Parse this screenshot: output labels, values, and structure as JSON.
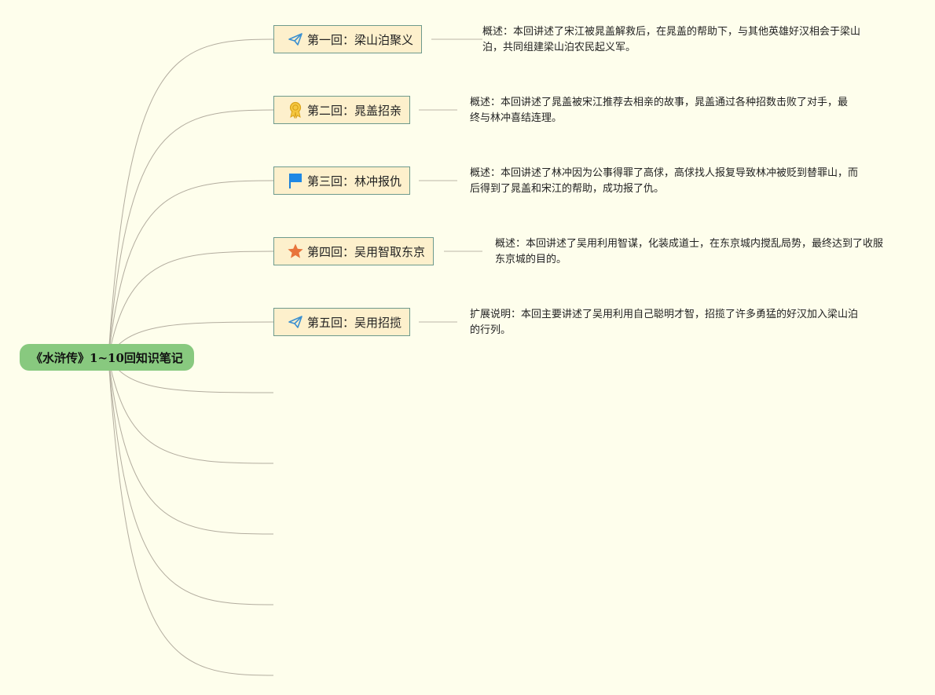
{
  "root": {
    "label": "《水浒传》1~10回知识笔记"
  },
  "chapters": [
    {
      "title": "第一回：梁山泊聚义",
      "icon": "paper-plane-icon",
      "note": "概述：本回讲述了宋江被晁盖解救后，在晁盖的帮助下，与其他英雄好汉相会于梁山泊，共同组建梁山泊农民起义军。"
    },
    {
      "title": "第二回：晁盖招亲",
      "icon": "award-medal-icon",
      "note": "概述：本回讲述了晁盖被宋江推荐去相亲的故事，晁盖通过各种招数击败了对手，最终与林冲喜结连理。"
    },
    {
      "title": "第三回：林冲报仇",
      "icon": "flag-icon",
      "note": "概述：本回讲述了林冲因为公事得罪了高俅，高俅找人报复导致林冲被贬到替罪山，而后得到了晁盖和宋江的帮助，成功报了仇。"
    },
    {
      "title": "第四回：吴用智取东京",
      "icon": "star-icon",
      "note": "概述：本回讲述了吴用利用智谋，化装成道士，在东京城内搅乱局势，最终达到了收服东京城的目的。"
    },
    {
      "title": "第五回：吴用招揽",
      "icon": "paper-plane-icon",
      "note": "扩展说明：本回主要讲述了吴用利用自己聪明才智，招揽了许多勇猛的好汉加入梁山泊的行列。"
    }
  ],
  "empty_branches": 5,
  "colors": {
    "background": "#fefeec",
    "root": "#88c97f",
    "node_fill": "#fdf0cc",
    "node_border": "#6e9a8c",
    "line": "#b3ad9f"
  }
}
